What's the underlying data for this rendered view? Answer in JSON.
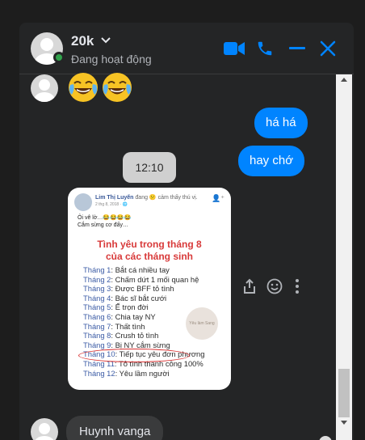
{
  "header": {
    "name": "20k",
    "status": "Đang hoạt động",
    "accent": "#0084ff"
  },
  "messages": {
    "emojis": [
      "face-with-tears-of-joy",
      "face-with-tears-of-joy"
    ],
    "outgoing": [
      "há há",
      "hay chớ"
    ],
    "time": "12:10",
    "incoming": "Huynh vanga"
  },
  "photo": {
    "author": "Lim Thị Luyến",
    "feeling": "đang 😕 cảm thấy thú vị.",
    "date": "2 thg 8, 2018 · 🌐",
    "line1": "Ôi vê lờ…😂😂😂😂",
    "line2": "Cắm sừng cơ đấy…",
    "title1": "Tình yêu trong tháng 8",
    "title2": "của các tháng sinh",
    "months": [
      {
        "m": "Tháng 1",
        "t": ": Bắt cá nhiều tay"
      },
      {
        "m": "Tháng 2",
        "t": ": Chấm dứt 1 mối quan hệ"
      },
      {
        "m": "Tháng 3",
        "t": ": Được BFF tỏ tình"
      },
      {
        "m": "Tháng 4",
        "t": ": Bác sĩ bắt cưới"
      },
      {
        "m": "Tháng 5",
        "t": ": Ế trọn đời"
      },
      {
        "m": "Tháng 6",
        "t": ": Chia tay NY"
      },
      {
        "m": "Tháng 7",
        "t": ": Thất tình"
      },
      {
        "m": "Tháng 8",
        "t": ": Crush tỏ tình"
      },
      {
        "m": "Tháng 9",
        "t": ": Bị NY cắm sừng"
      },
      {
        "m": "Tháng 10",
        "t": ": Tiếp tục yêu đơn phương"
      },
      {
        "m": "Tháng 11",
        "t": ": Tỏ tình thành công 100%"
      },
      {
        "m": "Tháng 12",
        "t": ": Yêu lầm người"
      }
    ],
    "stamp": "Yêu làm Sang"
  }
}
